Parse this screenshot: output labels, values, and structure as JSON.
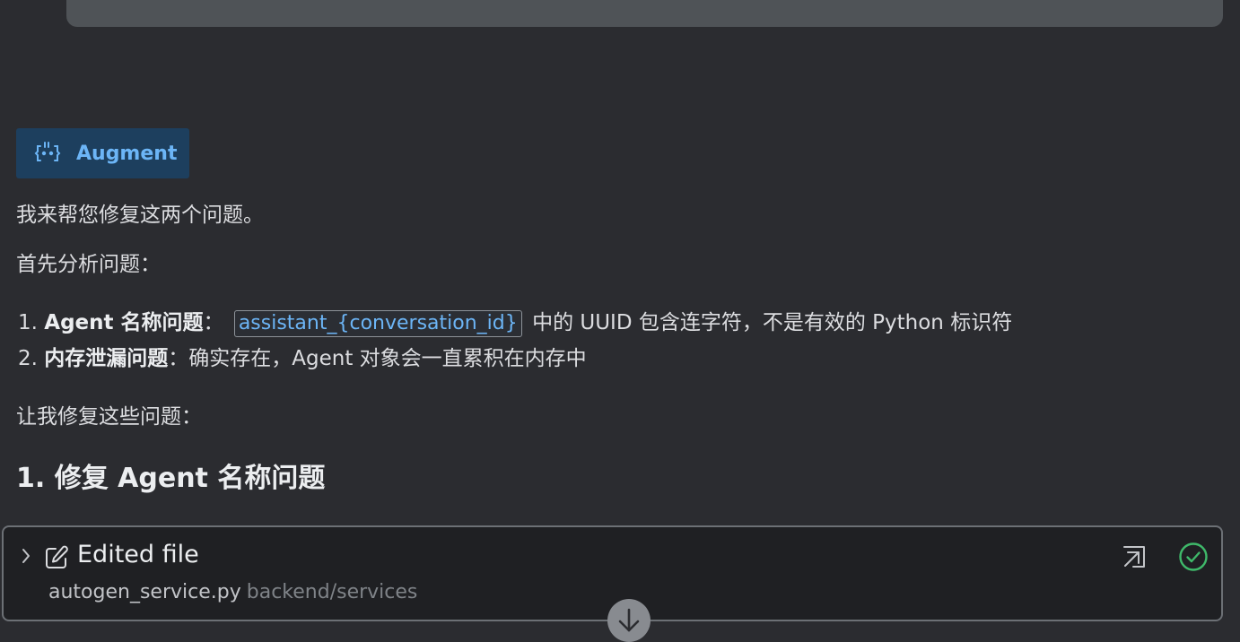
{
  "agent": {
    "name": "Augment",
    "icon": "augment-logo-icon"
  },
  "message": {
    "intro": "我来帮您修复这两个问题。",
    "analysis_lead": "首先分析问题：",
    "issues": [
      {
        "number": "1.",
        "title": "Agent 名称问题",
        "sep": "：",
        "code": "assistant_{conversation_id}",
        "text": "中的 UUID 包含连字符，不是有效的 Python 标识符"
      },
      {
        "number": "2.",
        "title": "内存泄漏问题",
        "sep": "：",
        "text": "确实存在，Agent 对象会一直累积在内存中"
      }
    ],
    "fix_lead": "让我修复这些问题：",
    "section_heading": "1. 修复 Agent 名称问题"
  },
  "edit_card": {
    "title": "Edited file",
    "filename": "autogen_service.py",
    "path": "backend/services",
    "status": "success",
    "icons": [
      "chevron-right-icon",
      "edit-icon",
      "open-external-icon",
      "check-circle-icon"
    ]
  },
  "colors": {
    "background": "#2b2c30",
    "accent": "#6cb5f6",
    "success": "#3fb96a"
  }
}
